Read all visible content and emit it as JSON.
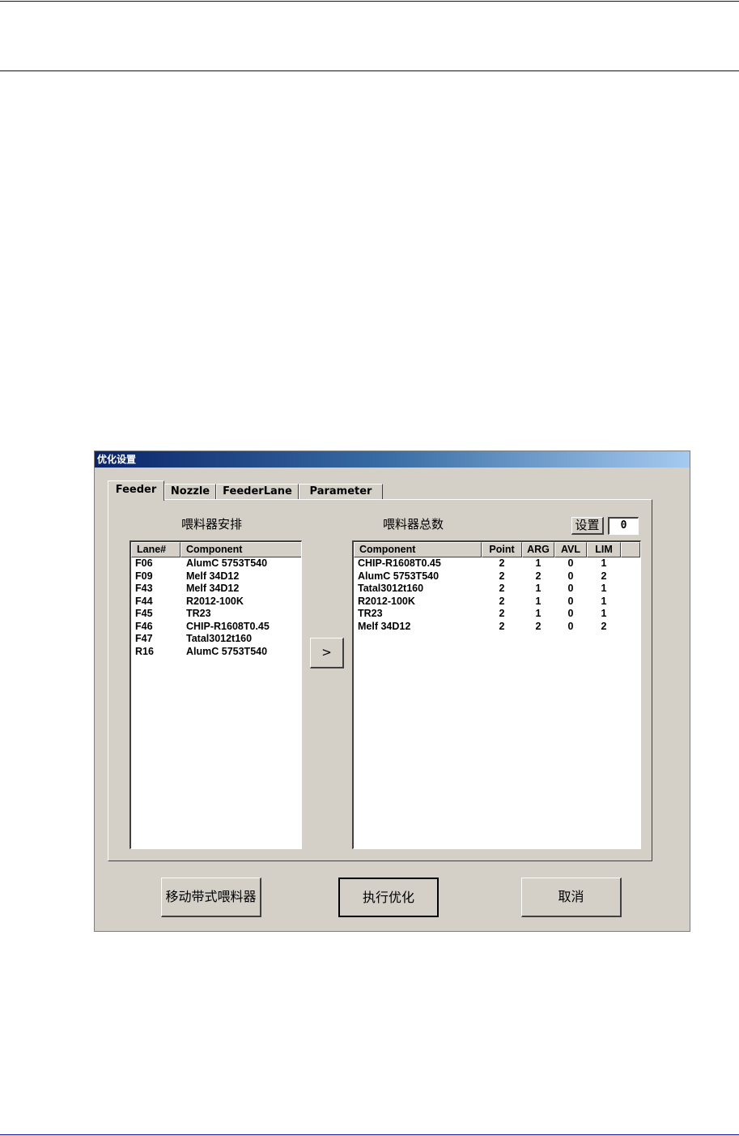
{
  "dialog": {
    "title": "优化设置",
    "tabs": [
      {
        "label": "Feeder",
        "active": true
      },
      {
        "label": "Nozzle",
        "active": false
      },
      {
        "label": "FeederLane",
        "active": false
      },
      {
        "label": "Parameter",
        "active": false
      }
    ],
    "left_caption": "喂料器安排",
    "right_caption": "喂料器总数",
    "set_button": "设置",
    "count_value": "0",
    "transfer_button": ">",
    "buttons": {
      "move_tape_feeder": "移动带式喂料器",
      "execute_optimize": "执行优化",
      "cancel": "取消"
    }
  },
  "feeder_list": {
    "headers": [
      "Lane#",
      "Component"
    ],
    "rows": [
      [
        "F06",
        "AlumC 5753T540"
      ],
      [
        "F09",
        "Melf 34D12"
      ],
      [
        "F43",
        "Melf 34D12"
      ],
      [
        "F44",
        "R2012-100K"
      ],
      [
        "F45",
        "TR23"
      ],
      [
        "F46",
        "CHIP-R1608T0.45"
      ],
      [
        "F47",
        "Tatal3012t160"
      ],
      [
        "R16",
        "AlumC 5753T540"
      ]
    ]
  },
  "component_list": {
    "headers": [
      "Component",
      "Point",
      "ARG",
      "AVL",
      "LIM"
    ],
    "rows": [
      [
        "CHIP-R1608T0.45",
        "2",
        "1",
        "0",
        "1"
      ],
      [
        "AlumC 5753T540",
        "2",
        "2",
        "0",
        "2"
      ],
      [
        "Tatal3012t160",
        "2",
        "1",
        "0",
        "1"
      ],
      [
        "R2012-100K",
        "2",
        "1",
        "0",
        "1"
      ],
      [
        "TR23",
        "2",
        "1",
        "0",
        "1"
      ],
      [
        "Melf 34D12",
        "2",
        "2",
        "0",
        "2"
      ]
    ]
  }
}
